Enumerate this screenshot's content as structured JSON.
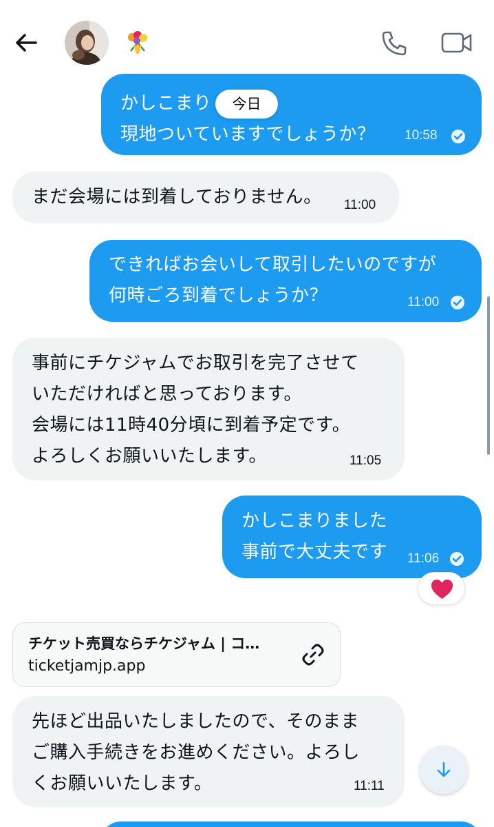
{
  "header": {
    "back_icon": "arrow-left-icon",
    "avatar_icon": "profile-photo",
    "name_emoji": "💐",
    "call_icon": "phone-icon",
    "video_icon": "video-camera-icon"
  },
  "date_separator": "今日",
  "messages": [
    {
      "direction": "out",
      "text": "かしこまり\n現地ついていますでしょうか？",
      "time": "10:58",
      "read": true
    },
    {
      "direction": "in",
      "text": "まだ会場には到着しておりません。",
      "time": "11:00"
    },
    {
      "direction": "out",
      "text": "できればお会いして取引したいのですが\n何時ごろ到着でしょうか？",
      "time": "11:00",
      "read": true
    },
    {
      "direction": "in",
      "text": "事前にチケジャムでお取引を完了させて\nいただければと思っております。\n会場には11時40分頃に到着予定です。\nよろしくお願いいたします。",
      "time": "11:05"
    },
    {
      "direction": "out",
      "text": "かしこまりました\n事前で大丈夫です",
      "time": "11:06",
      "read": true,
      "reaction": "❤️"
    },
    {
      "direction": "in",
      "text": "先ほど出品いたしましたので、そのまま\nご購入手続きをお進めください。よろし\nくお願いいたします。",
      "time": "11:11"
    }
  ],
  "link_card": {
    "title": "チケット売買ならチケジャム | コ…",
    "domain": "ticketjamjp.app",
    "icon": "link-icon"
  },
  "scroll_down_icon": "arrow-down-icon",
  "colors": {
    "accent": "#1d9bf0",
    "incoming_bg": "#eff3f4",
    "reaction": "#e0245e"
  }
}
